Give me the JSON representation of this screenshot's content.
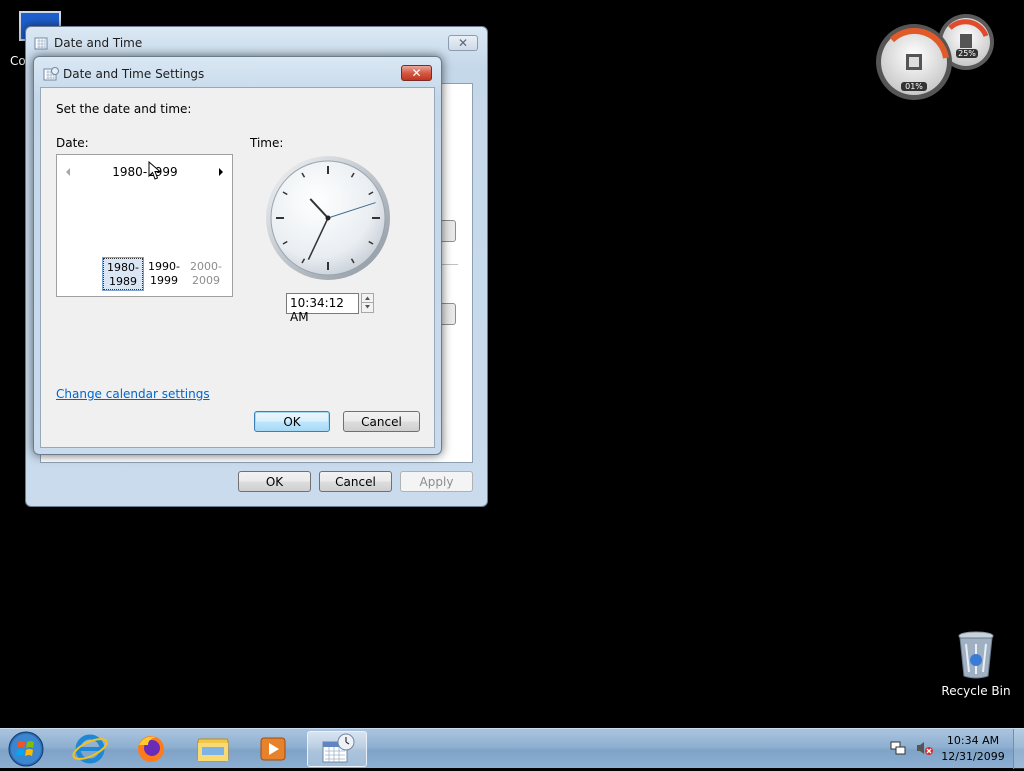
{
  "desktop": {
    "computer_label": "Co",
    "recycle_bin_label": "Recycle Bin"
  },
  "gadget": {
    "cpu_percent": "01%",
    "ram_percent": "25%"
  },
  "parent_window": {
    "title": "Date and Time",
    "ok_label": "OK",
    "cancel_label": "Cancel",
    "apply_label": "Apply"
  },
  "dialog": {
    "title": "Date and Time Settings",
    "instruction": "Set the date and time:",
    "date_label": "Date:",
    "time_label": "Time:",
    "calendar": {
      "header": "1980-1999",
      "cells": [
        {
          "line1": "1980-",
          "line2": "1989",
          "state": "selected"
        },
        {
          "line1": "1990-",
          "line2": "1999",
          "state": "normal"
        },
        {
          "line1": "2000-",
          "line2": "2009",
          "state": "out-of-range"
        }
      ]
    },
    "clock": {
      "hours": 10,
      "minutes": 34,
      "seconds": 12
    },
    "time_value": "10:34:12 AM",
    "change_calendar_link": "Change calendar settings",
    "ok_label": "OK",
    "cancel_label": "Cancel"
  },
  "taskbar": {
    "clock_time": "10:34 AM",
    "clock_date": "12/31/2099"
  },
  "colors": {
    "link": "#0066cc",
    "close_red": "#c74a3b",
    "selection": "#dbe6f4"
  }
}
